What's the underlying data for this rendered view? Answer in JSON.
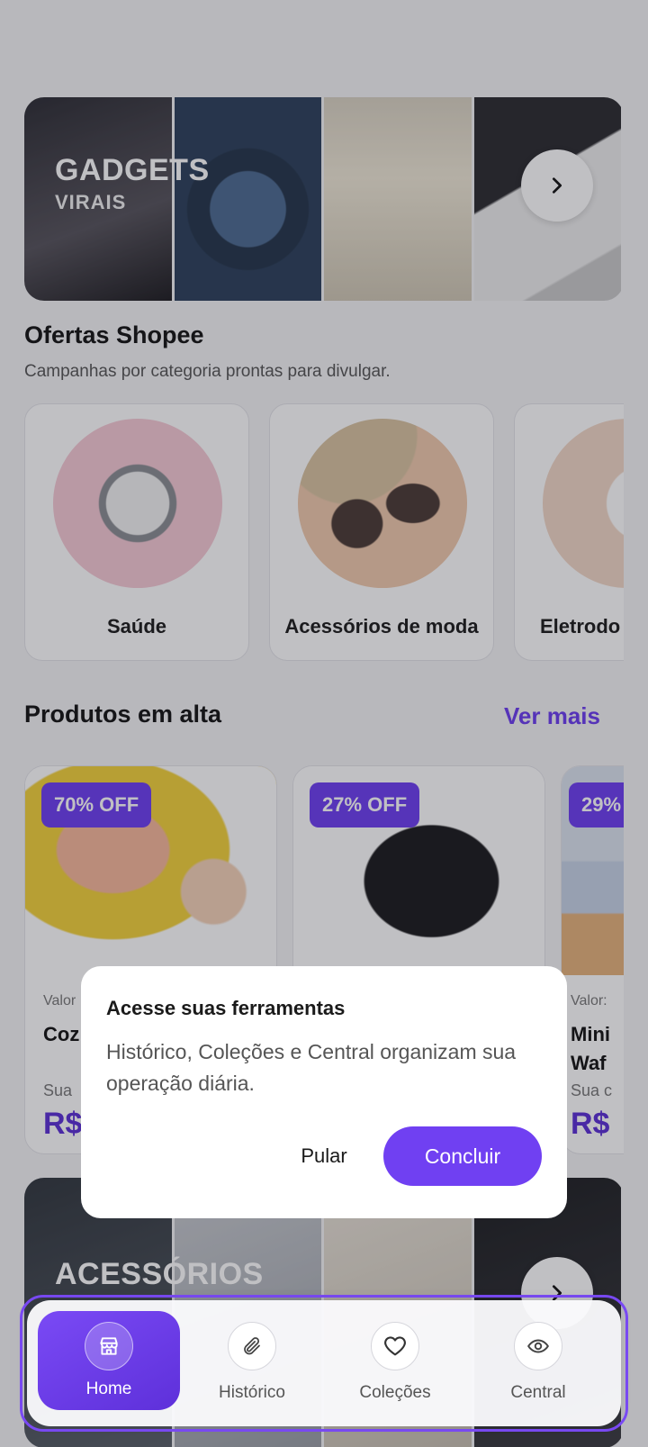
{
  "banner_top": {
    "title": "GADGETS",
    "subtitle": "VIRAIS"
  },
  "offers": {
    "title": "Ofertas Shopee",
    "subtitle": "Campanhas por categoria prontas para divulgar.",
    "categories": [
      {
        "label": "Saúde"
      },
      {
        "label": "Acessórios de moda"
      },
      {
        "label": "Eletrodo"
      }
    ]
  },
  "trending": {
    "title": "Produtos em alta",
    "see_more": "Ver mais",
    "products": [
      {
        "badge": "70% OFF",
        "valor": "Valor",
        "name": "Coz Por",
        "sub": "Sua",
        "price": "R$"
      },
      {
        "badge": "27% OFF",
        "valor": "",
        "name": "",
        "sub": "",
        "price": ""
      },
      {
        "badge": "29%",
        "valor": "Valor:",
        "name": "Mini Waf",
        "sub": "Sua c",
        "price": "R$"
      }
    ]
  },
  "banner_bottom": {
    "title": "ACESSÓRIOS"
  },
  "dialog": {
    "title": "Acesse suas ferramentas",
    "body": "Histórico, Coleções e Central organizam sua operação diária.",
    "skip": "Pular",
    "done": "Concluir"
  },
  "nav": {
    "items": [
      {
        "label": "Home",
        "icon": "store-icon"
      },
      {
        "label": "Histórico",
        "icon": "paperclip-icon"
      },
      {
        "label": "Coleções",
        "icon": "heart-icon"
      },
      {
        "label": "Central",
        "icon": "eye-icon"
      }
    ]
  },
  "colors": {
    "accent": "#6d3df2",
    "accent_dark": "#5b2fd6"
  }
}
